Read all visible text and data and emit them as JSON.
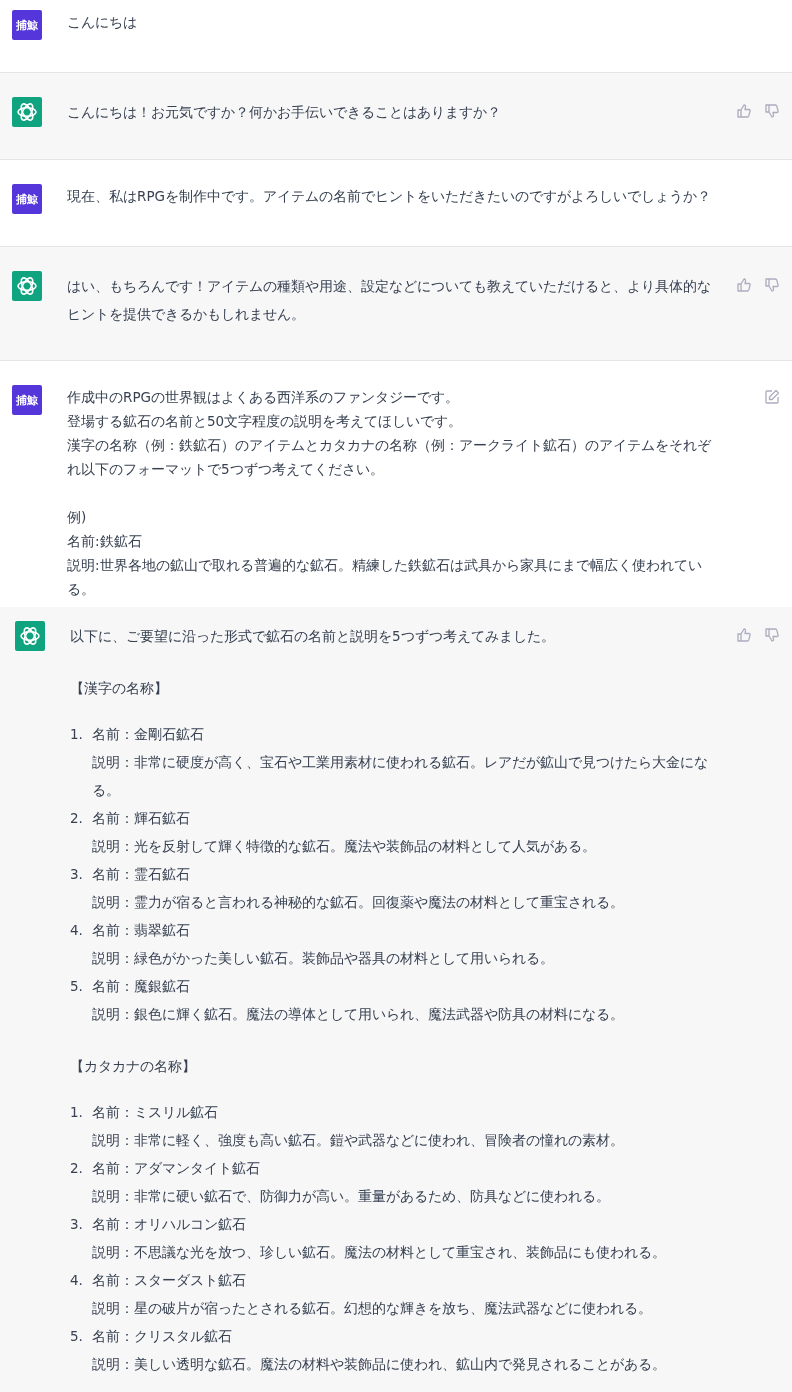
{
  "messages": [
    {
      "kind": "user",
      "avatar": "捕鯨",
      "editable": false,
      "blocks": [
        {
          "kind": "text",
          "lines": [
            "こんにちは"
          ]
        }
      ]
    },
    {
      "kind": "assistant",
      "blocks": [
        {
          "kind": "text",
          "lines": [
            "こんにちは！お元気ですか？何かお手伝いできることはありますか？"
          ]
        }
      ]
    },
    {
      "kind": "user",
      "avatar": "捕鯨",
      "editable": false,
      "blocks": [
        {
          "kind": "text",
          "lines": [
            "現在、私はRPGを制作中です。アイテムの名前でヒントをいただきたいのですがよろしいでしょうか？"
          ]
        }
      ]
    },
    {
      "kind": "assistant",
      "blocks": [
        {
          "kind": "text",
          "lines": [
            "はい、もちろんです！アイテムの種類や用途、設定などについても教えていただけると、より具体的なヒントを提供できるかもしれません。"
          ]
        }
      ]
    },
    {
      "kind": "user",
      "avatar": "捕鯨",
      "editable": true,
      "blocks": [
        {
          "kind": "text",
          "lines": [
            "作成中のRPGの世界観はよくある西洋系のファンタジーです。",
            "登場する鉱石の名前と50文字程度の説明を考えてほしいです。",
            "漢字の名称（例：鉄鉱石）のアイテムとカタカナの名称（例：アークライト鉱石）のアイテムをそれぞれ以下のフォーマットで5つずつ考えてください。"
          ]
        },
        {
          "kind": "text",
          "lines": [
            "例)",
            "名前:鉄鉱石",
            "説明:世界各地の鉱山で取れる普遍的な鉱石。精練した鉄鉱石は武具から家具にまで幅広く使われている。"
          ]
        }
      ]
    },
    {
      "kind": "assistant",
      "blocks": [
        {
          "kind": "text",
          "lines": [
            "以下に、ご要望に沿った形式で鉱石の名前と説明を5つずつ考えてみました。"
          ]
        },
        {
          "kind": "text",
          "lines": [
            "【漢字の名称】"
          ]
        },
        {
          "kind": "list",
          "items": [
            {
              "number": "1.",
              "name": "名前：金剛石鉱石",
              "description": "説明：非常に硬度が高く、宝石や工業用素材に使われる鉱石。レアだが鉱山で見つけたら大金になる。"
            },
            {
              "number": "2.",
              "name": "名前：輝石鉱石",
              "description": "説明：光を反射して輝く特徴的な鉱石。魔法や装飾品の材料として人気がある。"
            },
            {
              "number": "3.",
              "name": "名前：霊石鉱石",
              "description": "説明：霊力が宿ると言われる神秘的な鉱石。回復薬や魔法の材料として重宝される。"
            },
            {
              "number": "4.",
              "name": "名前：翡翠鉱石",
              "description": "説明：緑色がかった美しい鉱石。装飾品や器具の材料として用いられる。"
            },
            {
              "number": "5.",
              "name": "名前：魔銀鉱石",
              "description": "説明：銀色に輝く鉱石。魔法の導体として用いられ、魔法武器や防具の材料になる。"
            }
          ]
        },
        {
          "kind": "text",
          "lines": [
            "【カタカナの名称】"
          ]
        },
        {
          "kind": "list",
          "items": [
            {
              "number": "1.",
              "name": "名前：ミスリル鉱石",
              "description": "説明：非常に軽く、強度も高い鉱石。鎧や武器などに使われ、冒険者の憧れの素材。"
            },
            {
              "number": "2.",
              "name": "名前：アダマンタイト鉱石",
              "description": "説明：非常に硬い鉱石で、防御力が高い。重量があるため、防具などに使われる。"
            },
            {
              "number": "3.",
              "name": "名前：オリハルコン鉱石",
              "description": "説明：不思議な光を放つ、珍しい鉱石。魔法の材料として重宝され、装飾品にも使われる。"
            },
            {
              "number": "4.",
              "name": "名前：スターダスト鉱石",
              "description": "説明：星の破片が宿ったとされる鉱石。幻想的な輝きを放ち、魔法武器などに使われる。"
            },
            {
              "number": "5.",
              "name": "名前：クリスタル鉱石",
              "description": "説明：美しい透明な鉱石。魔法の材料や装飾品に使われ、鉱山内で発見されることがある。"
            }
          ]
        }
      ]
    }
  ]
}
